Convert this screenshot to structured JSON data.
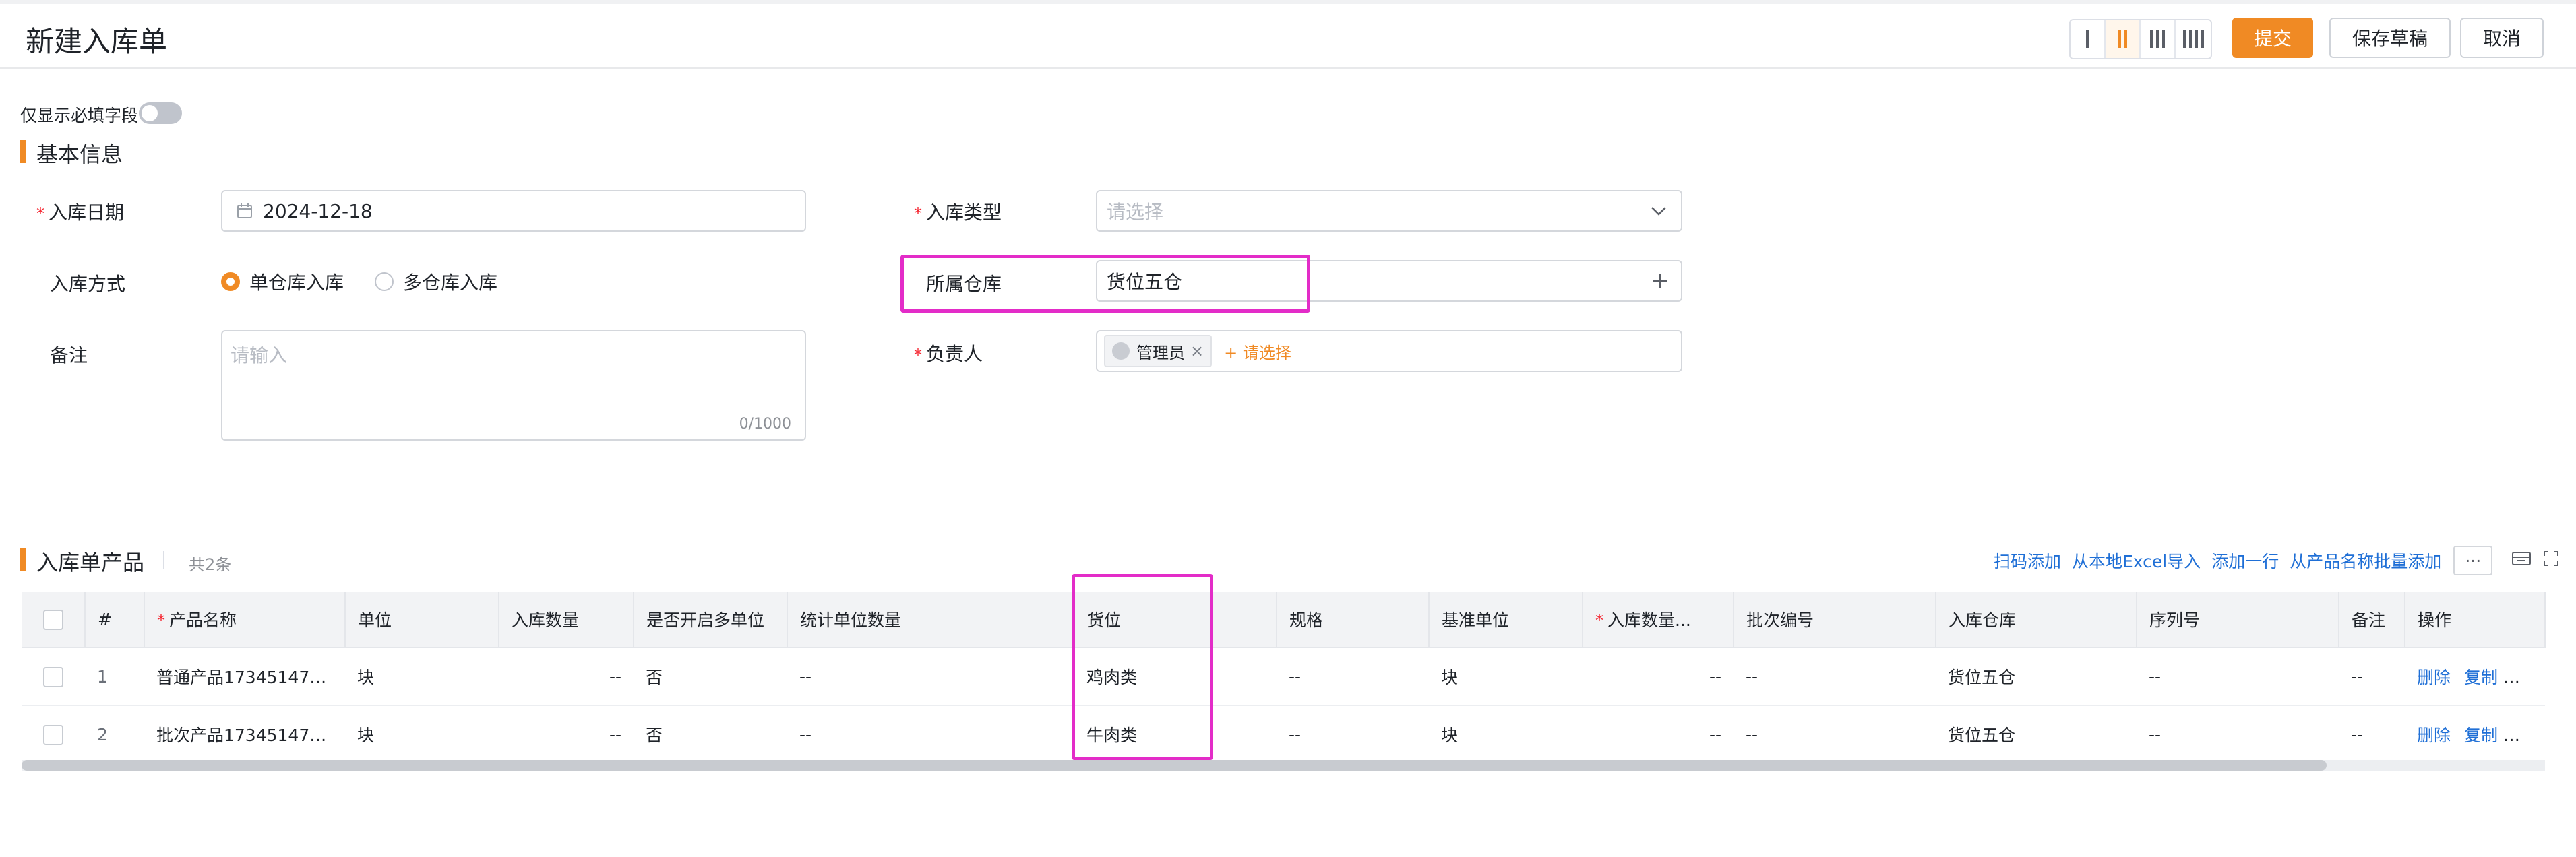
{
  "header": {
    "title": "新建入库单",
    "submit": "提交",
    "save_draft": "保存草稿",
    "cancel": "取消"
  },
  "toggle": {
    "label": "仅显示必填字段",
    "on": false
  },
  "basic_section": {
    "title": "基本信息"
  },
  "form": {
    "date_label": "入库日期",
    "date_value": "2024-12-18",
    "method_label": "入库方式",
    "method_options": [
      "单仓库入库",
      "多仓库入库"
    ],
    "method_selected": "单仓库入库",
    "note_label": "备注",
    "note_placeholder": "请输入",
    "note_counter": "0/1000",
    "type_label": "入库类型",
    "type_placeholder": "请选择",
    "warehouse_label": "所属仓库",
    "warehouse_value": "货位五仓",
    "owner_label": "负责人",
    "owner_tag": "管理员",
    "owner_add": "+ 请选择"
  },
  "products_section": {
    "title": "入库单产品",
    "count": "共2条",
    "actions": [
      "扫码添加",
      "从本地Excel导入",
      "添加一行",
      "从产品名称批量添加"
    ],
    "more": "···"
  },
  "table": {
    "columns": [
      "#",
      "产品名称",
      "单位",
      "入库数量",
      "是否开启多单位",
      "统计单位数量",
      "货位",
      "规格",
      "基准单位",
      "入库数量...",
      "批次编号",
      "入库仓库",
      "序列号",
      "备注",
      "操作"
    ],
    "rows": [
      {
        "idx": "1",
        "name": "普通产品1734514770...",
        "unit": "块",
        "qty": "--",
        "multi": "否",
        "stat_qty": "--",
        "location": "鸡肉类",
        "spec": "--",
        "base_unit": "块",
        "qty2": "--",
        "batch": "--",
        "warehouse": "货位五仓",
        "serial": "--",
        "note": "--",
        "delete": "删除",
        "copy": "复制"
      },
      {
        "idx": "2",
        "name": "批次产品1734514723...",
        "unit": "块",
        "qty": "--",
        "multi": "否",
        "stat_qty": "--",
        "location": "牛肉类",
        "spec": "--",
        "base_unit": "块",
        "qty2": "--",
        "batch": "--",
        "warehouse": "货位五仓",
        "serial": "--",
        "note": "--",
        "delete": "删除",
        "copy": "复制"
      }
    ]
  },
  "colors": {
    "accent": "#f08a24",
    "link": "#1f6fd6",
    "highlight": "#e32cc8",
    "required": "#f5222d"
  }
}
